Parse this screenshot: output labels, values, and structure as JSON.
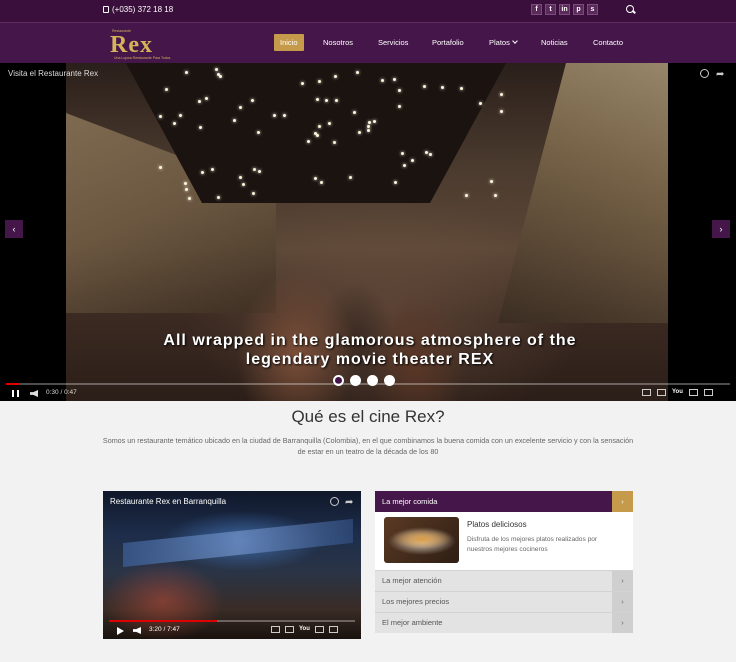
{
  "topbar": {
    "phone": "(+035) 372 18 18",
    "socials": [
      {
        "icon": "facebook-icon",
        "glyph": "f"
      },
      {
        "icon": "twitter-icon",
        "glyph": "t"
      },
      {
        "icon": "linkedin-icon",
        "glyph": "in"
      },
      {
        "icon": "pinterest-icon",
        "glyph": "p"
      },
      {
        "icon": "skype-icon",
        "glyph": "s"
      }
    ]
  },
  "logo": {
    "text": "Rex",
    "top": "Restaurante",
    "sub": "Una Lujosa Restaurante Para Todos"
  },
  "nav": [
    {
      "label": "Inicio",
      "active": true
    },
    {
      "label": "Nosotros"
    },
    {
      "label": "Servicios"
    },
    {
      "label": "Portafolio"
    },
    {
      "label": "Platos",
      "dropdown": true
    },
    {
      "label": "Noticias"
    },
    {
      "label": "Contacto"
    }
  ],
  "hero": {
    "video_title": "Visita el Restaurante Rex",
    "caption_line1": "All wrapped in the glamorous atmosphere of the",
    "caption_line2": "legendary movie theater REX",
    "time": "0:30 / 0:47",
    "progress": 0.02,
    "slides": 4,
    "active_slide": 0,
    "prev": "‹",
    "next": "›"
  },
  "intro": {
    "title": "Qué es el cine Rex?",
    "description": "Somos un restaurante temático ubicado en la ciudad de Barranquilla (Colombia), en el que combinamos la buena comida con un excelente servicio y con la sensación de estar en un teatro de la década de los 80"
  },
  "video2": {
    "title": "Restaurante Rex en Barranquilla",
    "time": "3:20 / 7:47",
    "progress": 0.44
  },
  "accordion": {
    "open": {
      "label": "La mejor comida",
      "item_title": "Platos deliciosos",
      "item_desc": "Disfruta de los mejores platos realizados por nuestros mejores cocineros"
    },
    "rows": [
      {
        "label": "La mejor atención"
      },
      {
        "label": "Los mejores precios"
      },
      {
        "label": "El mejor ambiente"
      }
    ],
    "chevron": "›"
  }
}
